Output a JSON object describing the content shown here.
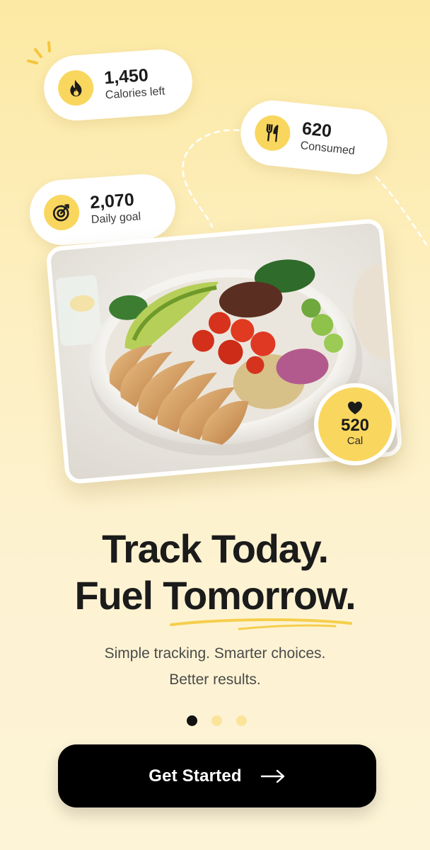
{
  "stats": [
    {
      "value": "1,450",
      "label": "Calories left",
      "icon": "flame-icon"
    },
    {
      "value": "620",
      "label": "Consumed",
      "icon": "fork-knife-icon"
    },
    {
      "value": "2,070",
      "label": "Daily goal",
      "icon": "target-icon"
    }
  ],
  "meal_badge": {
    "value": "520",
    "label": "Cal",
    "icon": "heart-icon"
  },
  "headline": {
    "line1": "Track Today.",
    "line2": "Fuel Tomorrow."
  },
  "subtitle": {
    "line1": "Simple tracking. Smarter choices.",
    "line2": "Better results."
  },
  "pagination": {
    "current": 1,
    "total": 3
  },
  "cta": {
    "label": "Get Started",
    "icon": "arrow-right-icon"
  },
  "colors": {
    "accent": "#F9D65E",
    "button": "#000000",
    "background_top": "#FCE9A3",
    "background_bottom": "#FDF3D6"
  }
}
